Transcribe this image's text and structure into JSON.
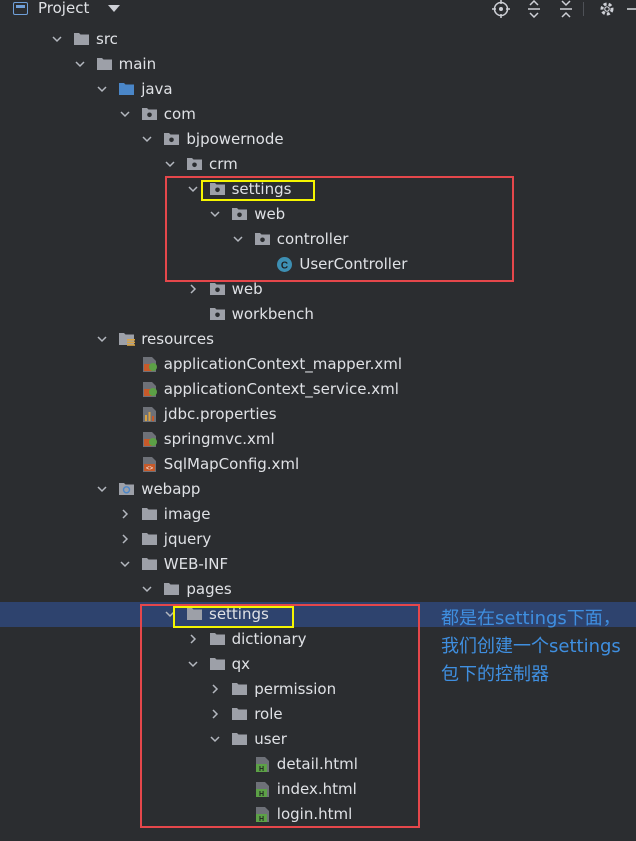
{
  "toolbar": {
    "title": "Project",
    "icons": [
      "locate-icon",
      "expand-all-icon",
      "collapse-all-icon",
      "gear-icon",
      "hide-icon"
    ]
  },
  "tree": [
    {
      "label": "src",
      "depth": 0,
      "icon": "folder",
      "expanded": true
    },
    {
      "label": "main",
      "depth": 1,
      "icon": "folder",
      "expanded": true
    },
    {
      "label": "java",
      "depth": 2,
      "icon": "source-folder",
      "expanded": true
    },
    {
      "label": "com",
      "depth": 3,
      "icon": "package",
      "expanded": true
    },
    {
      "label": "bjpowernode",
      "depth": 4,
      "icon": "package",
      "expanded": true
    },
    {
      "label": "crm",
      "depth": 5,
      "icon": "package",
      "expanded": true
    },
    {
      "label": "settings",
      "depth": 6,
      "icon": "package",
      "expanded": true
    },
    {
      "label": "web",
      "depth": 7,
      "icon": "package",
      "expanded": true
    },
    {
      "label": "controller",
      "depth": 8,
      "icon": "package",
      "expanded": true
    },
    {
      "label": "UserController",
      "depth": 9,
      "icon": "class",
      "leaf": true
    },
    {
      "label": "web",
      "depth": 6,
      "icon": "package",
      "expanded": false
    },
    {
      "label": "workbench",
      "depth": 6,
      "icon": "package",
      "leaf": true
    },
    {
      "label": "resources",
      "depth": 2,
      "icon": "resources-folder",
      "expanded": true
    },
    {
      "label": "applicationContext_mapper.xml",
      "depth": 3,
      "icon": "spring-xml",
      "leaf": true
    },
    {
      "label": "applicationContext_service.xml",
      "depth": 3,
      "icon": "spring-xml",
      "leaf": true
    },
    {
      "label": "jdbc.properties",
      "depth": 3,
      "icon": "properties",
      "leaf": true
    },
    {
      "label": "springmvc.xml",
      "depth": 3,
      "icon": "spring-xml",
      "leaf": true
    },
    {
      "label": "SqlMapConfig.xml",
      "depth": 3,
      "icon": "xml",
      "leaf": true
    },
    {
      "label": "webapp",
      "depth": 2,
      "icon": "web-folder",
      "expanded": true
    },
    {
      "label": "image",
      "depth": 3,
      "icon": "folder",
      "expanded": false
    },
    {
      "label": "jquery",
      "depth": 3,
      "icon": "folder",
      "expanded": false
    },
    {
      "label": "WEB-INF",
      "depth": 3,
      "icon": "folder",
      "expanded": true
    },
    {
      "label": "pages",
      "depth": 4,
      "icon": "folder",
      "expanded": true
    },
    {
      "label": "settings",
      "depth": 5,
      "icon": "folder",
      "expanded": true,
      "selected": true
    },
    {
      "label": "dictionary",
      "depth": 6,
      "icon": "folder",
      "expanded": false
    },
    {
      "label": "qx",
      "depth": 6,
      "icon": "folder",
      "expanded": true
    },
    {
      "label": "permission",
      "depth": 7,
      "icon": "folder",
      "expanded": false
    },
    {
      "label": "role",
      "depth": 7,
      "icon": "folder",
      "expanded": false
    },
    {
      "label": "user",
      "depth": 7,
      "icon": "folder",
      "expanded": true
    },
    {
      "label": "detail.html",
      "depth": 8,
      "icon": "html",
      "leaf": true
    },
    {
      "label": "index.html",
      "depth": 8,
      "icon": "html",
      "leaf": true
    },
    {
      "label": "login.html",
      "depth": 8,
      "icon": "html",
      "leaf": true
    }
  ],
  "annotation": {
    "text": "都是在settings下面，我们创建一个settings包下的控制器",
    "color": "#3f8fe0"
  },
  "colors": {
    "background": "#2b2d30",
    "selection": "#2e436e",
    "highlight_yellow": "#f5f500",
    "highlight_red": "#e5474b"
  }
}
